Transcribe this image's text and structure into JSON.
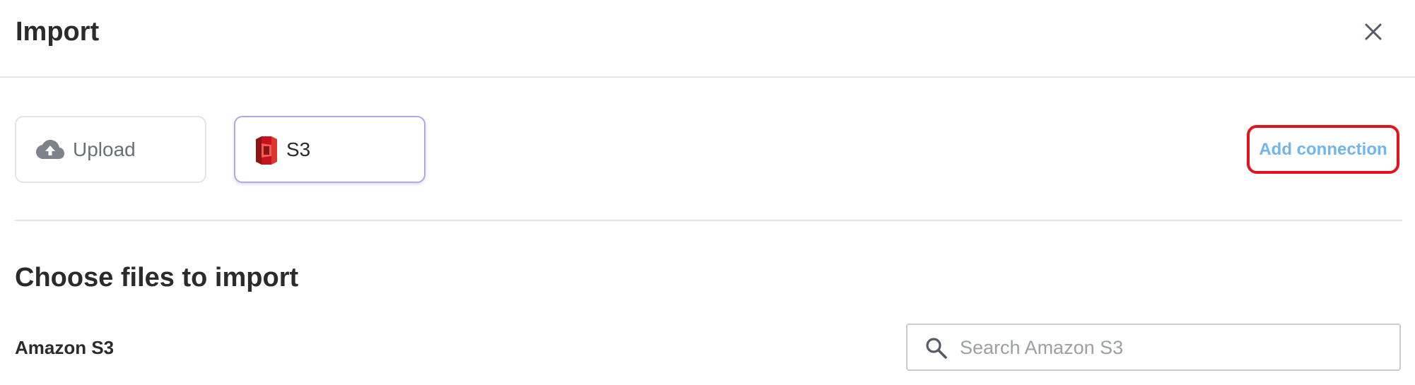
{
  "dialog": {
    "title": "Import",
    "close_icon": "close-icon"
  },
  "sources": {
    "upload": {
      "label": "Upload",
      "icon": "cloud-upload-icon"
    },
    "s3": {
      "label": "S3",
      "icon": "s3-bucket-icon",
      "selected": true
    }
  },
  "actions": {
    "add_connection": "Add connection"
  },
  "content": {
    "section_title": "Choose files to import",
    "source_name": "Amazon S3"
  },
  "search": {
    "placeholder": "Search Amazon S3",
    "value": "",
    "icon": "search-icon"
  },
  "colors": {
    "link": "#6fb6ee",
    "highlight": "#e3131a",
    "s3_brand": "#c7131f",
    "selected_border": "#b3a8e0"
  }
}
